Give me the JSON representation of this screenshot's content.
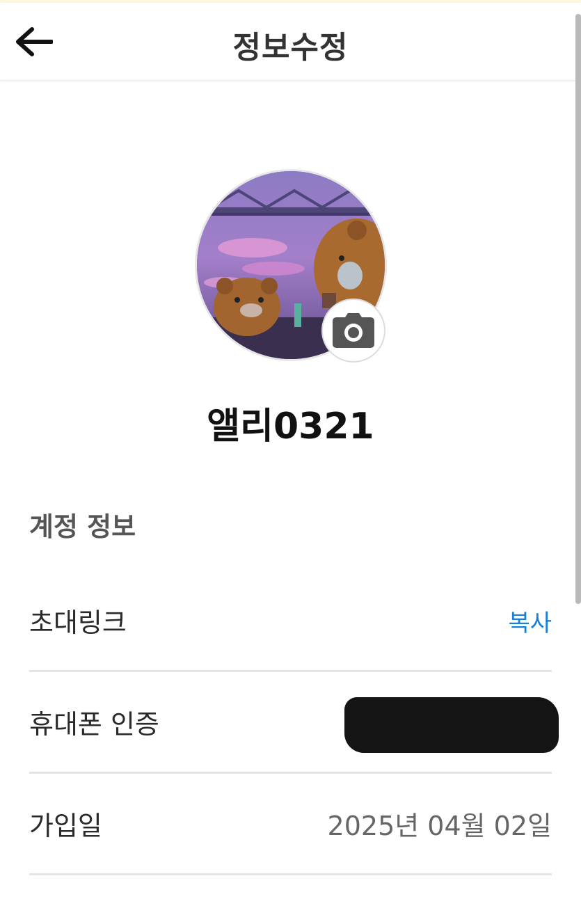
{
  "header": {
    "title": "정보수정",
    "back_icon": "arrow-left-icon"
  },
  "profile": {
    "nickname": "앨리0321",
    "camera_icon": "camera-icon"
  },
  "account_section": {
    "title": "계정 정보",
    "rows": [
      {
        "label": "초대링크",
        "action": "복사"
      },
      {
        "label": "휴대폰 인증",
        "value_redacted": true
      },
      {
        "label": "가입일",
        "value": "2025년 04월 02일"
      }
    ]
  },
  "colors": {
    "accent_link": "#1a7fd6",
    "divider": "#e4e4e4",
    "header_title": "#333333"
  }
}
